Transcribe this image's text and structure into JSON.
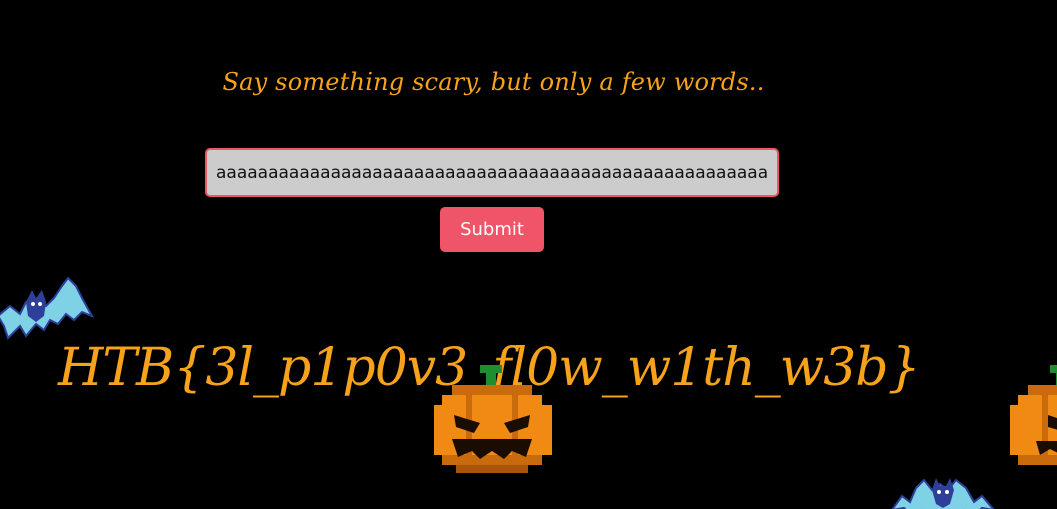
{
  "form": {
    "prompt": "Say something scary, but only a few words..",
    "input_value": "aaaaaaaaaaaaaaaaaaaaaaaaaaaaaaaaaaaaaaaaaaaaaaaaaaaaaaaaaaa",
    "submit_label": "Submit"
  },
  "result": {
    "flag_text": "HTB{3l_p1p0v3_fl0w_w1th_w3b}"
  },
  "colors": {
    "background": "#000000",
    "accent_orange": "#f7a21b",
    "button_red": "#f05468",
    "input_bg": "#cccccc"
  },
  "decorations": {
    "icons": [
      "bat-icon",
      "pumpkin-icon",
      "pumpkin-icon",
      "bat-icon"
    ]
  }
}
